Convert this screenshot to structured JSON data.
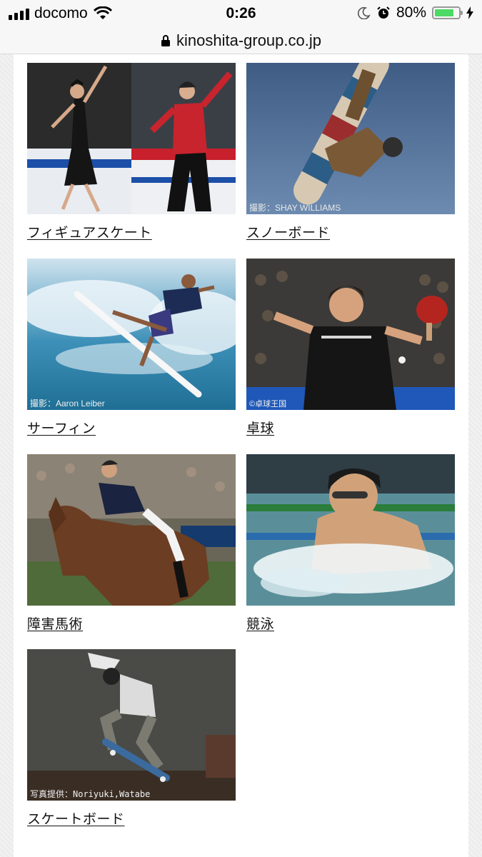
{
  "status_bar": {
    "carrier": "docomo",
    "time": "0:26",
    "battery_percent": "80%",
    "battery_level": 0.8
  },
  "browser": {
    "url": "kinoshita-group.co.jp"
  },
  "sports": [
    {
      "label": "フィギュアスケート",
      "credit": ""
    },
    {
      "label": "スノーボード",
      "credit": "撮影：SHAY WILLIAMS"
    },
    {
      "label": "サーフィン",
      "credit": "撮影：Aaron Leiber"
    },
    {
      "label": "卓球",
      "credit": "©卓球王国"
    },
    {
      "label": "障害馬術",
      "credit": ""
    },
    {
      "label": "競泳",
      "credit": ""
    },
    {
      "label": "スケートボード",
      "credit": "写真提供：Noriyuki,Watabe"
    }
  ]
}
